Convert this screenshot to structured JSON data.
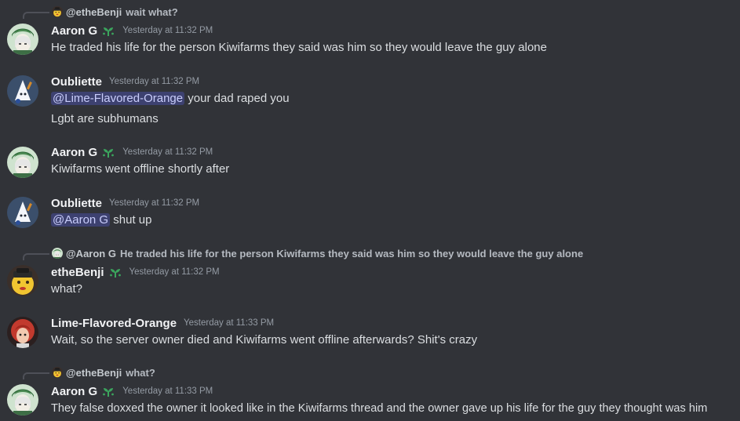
{
  "colors": {
    "background": "#313338",
    "username": "#f2f3f5",
    "timestamp": "#949ba4",
    "mention_bg": "#3c4270",
    "mention_fg": "#c9cdfb",
    "sprout": "#3ba55d"
  },
  "messages": [
    {
      "reply": {
        "name": "@etheBenji",
        "text": "wait what?"
      },
      "username": "Aaron G",
      "badge": "sprout-icon",
      "timestamp": "Yesterday at 11:32 PM",
      "lines": [
        "He traded his life for the person Kiwifarms they said was him so they would leave the guy alone"
      ]
    },
    {
      "username": "Oubliette",
      "timestamp": "Yesterday at 11:32 PM",
      "mention": "@Lime-Flavored-Orange",
      "mention_tail": " your dad raped you",
      "lines": [
        "Lgbt are subhumans"
      ]
    },
    {
      "username": "Aaron G",
      "badge": "sprout-icon",
      "timestamp": "Yesterday at 11:32 PM",
      "lines": [
        "Kiwifarms went offline shortly after"
      ]
    },
    {
      "username": "Oubliette",
      "timestamp": "Yesterday at 11:32 PM",
      "mention": "@Aaron G",
      "mention_tail": " shut up"
    },
    {
      "reply": {
        "name": "@Aaron G",
        "text": "He traded his life for the person Kiwifarms they said was him so they would leave the guy alone"
      },
      "username": "etheBenji",
      "badge": "sprout-icon",
      "timestamp": "Yesterday at 11:32 PM",
      "lines": [
        "what?"
      ]
    },
    {
      "username": "Lime-Flavored-Orange",
      "timestamp": "Yesterday at 11:33 PM",
      "lines": [
        "Wait, so the server owner died and Kiwifarms went offline afterwards? Shit's crazy"
      ]
    },
    {
      "reply": {
        "name": "@etheBenji",
        "text": "what?"
      },
      "username": "Aaron G",
      "badge": "sprout-icon",
      "timestamp": "Yesterday at 11:33 PM",
      "lines": [
        "They false doxxed the owner it looked like in the Kiwifarms thread and the owner gave up his life for the guy they thought was him"
      ]
    }
  ]
}
